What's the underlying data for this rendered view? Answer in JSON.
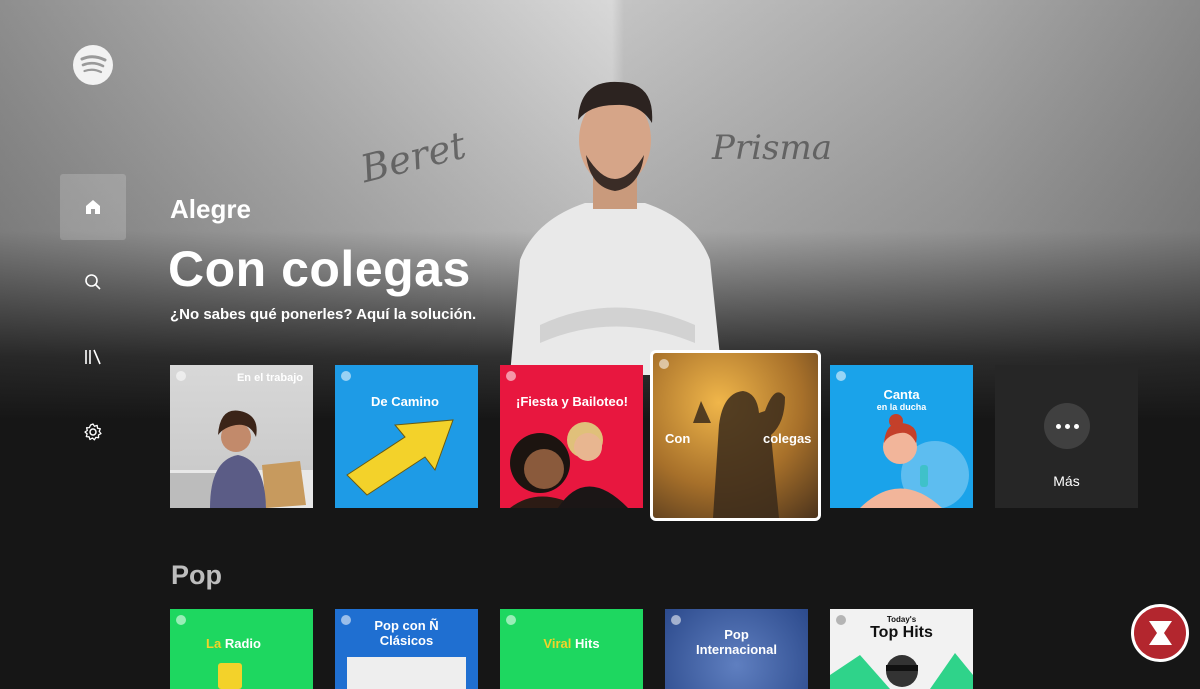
{
  "hero": {
    "eyebrow": "Alegre",
    "title": "Con colegas",
    "subtitle": "¿No sabes qué ponerles? Aquí la solución.",
    "signature_left": "Beret",
    "signature_right": "Prisma"
  },
  "sidebar": {
    "items": [
      {
        "name": "home",
        "icon": "home-icon",
        "active": true
      },
      {
        "name": "search",
        "icon": "search-icon",
        "active": false
      },
      {
        "name": "library",
        "icon": "library-icon",
        "active": false
      },
      {
        "name": "settings",
        "icon": "gear-icon",
        "active": false
      }
    ]
  },
  "playlists": [
    {
      "label": "En el trabajo",
      "color": "#d9d9d9"
    },
    {
      "label": "De Camino",
      "color": "#1e9be6"
    },
    {
      "label": "¡Fiesta y Bailoteo!",
      "color": "#e8173f"
    },
    {
      "label_line1": "Con",
      "label_line2": "colegas",
      "color": "#c88a2e",
      "focused": true
    },
    {
      "label": "Canta",
      "label_sub": "en la ducha",
      "color": "#1aa3ea"
    }
  ],
  "more": {
    "label": "Más"
  },
  "pop_section": {
    "title": "Pop",
    "cards": [
      {
        "label_a": "La",
        "label_b": "Radio",
        "color": "#1ed760"
      },
      {
        "label": "Pop con Ñ Clásicos",
        "color": "#1f6fd1"
      },
      {
        "label_a": "Viral",
        "label_b": "Hits",
        "color": "#1ed760"
      },
      {
        "label": "Pop Internacional",
        "color": "#3b5fa8"
      },
      {
        "label_small": "Today's",
        "label": "Top Hits",
        "color": "#f2f2f2"
      }
    ]
  }
}
